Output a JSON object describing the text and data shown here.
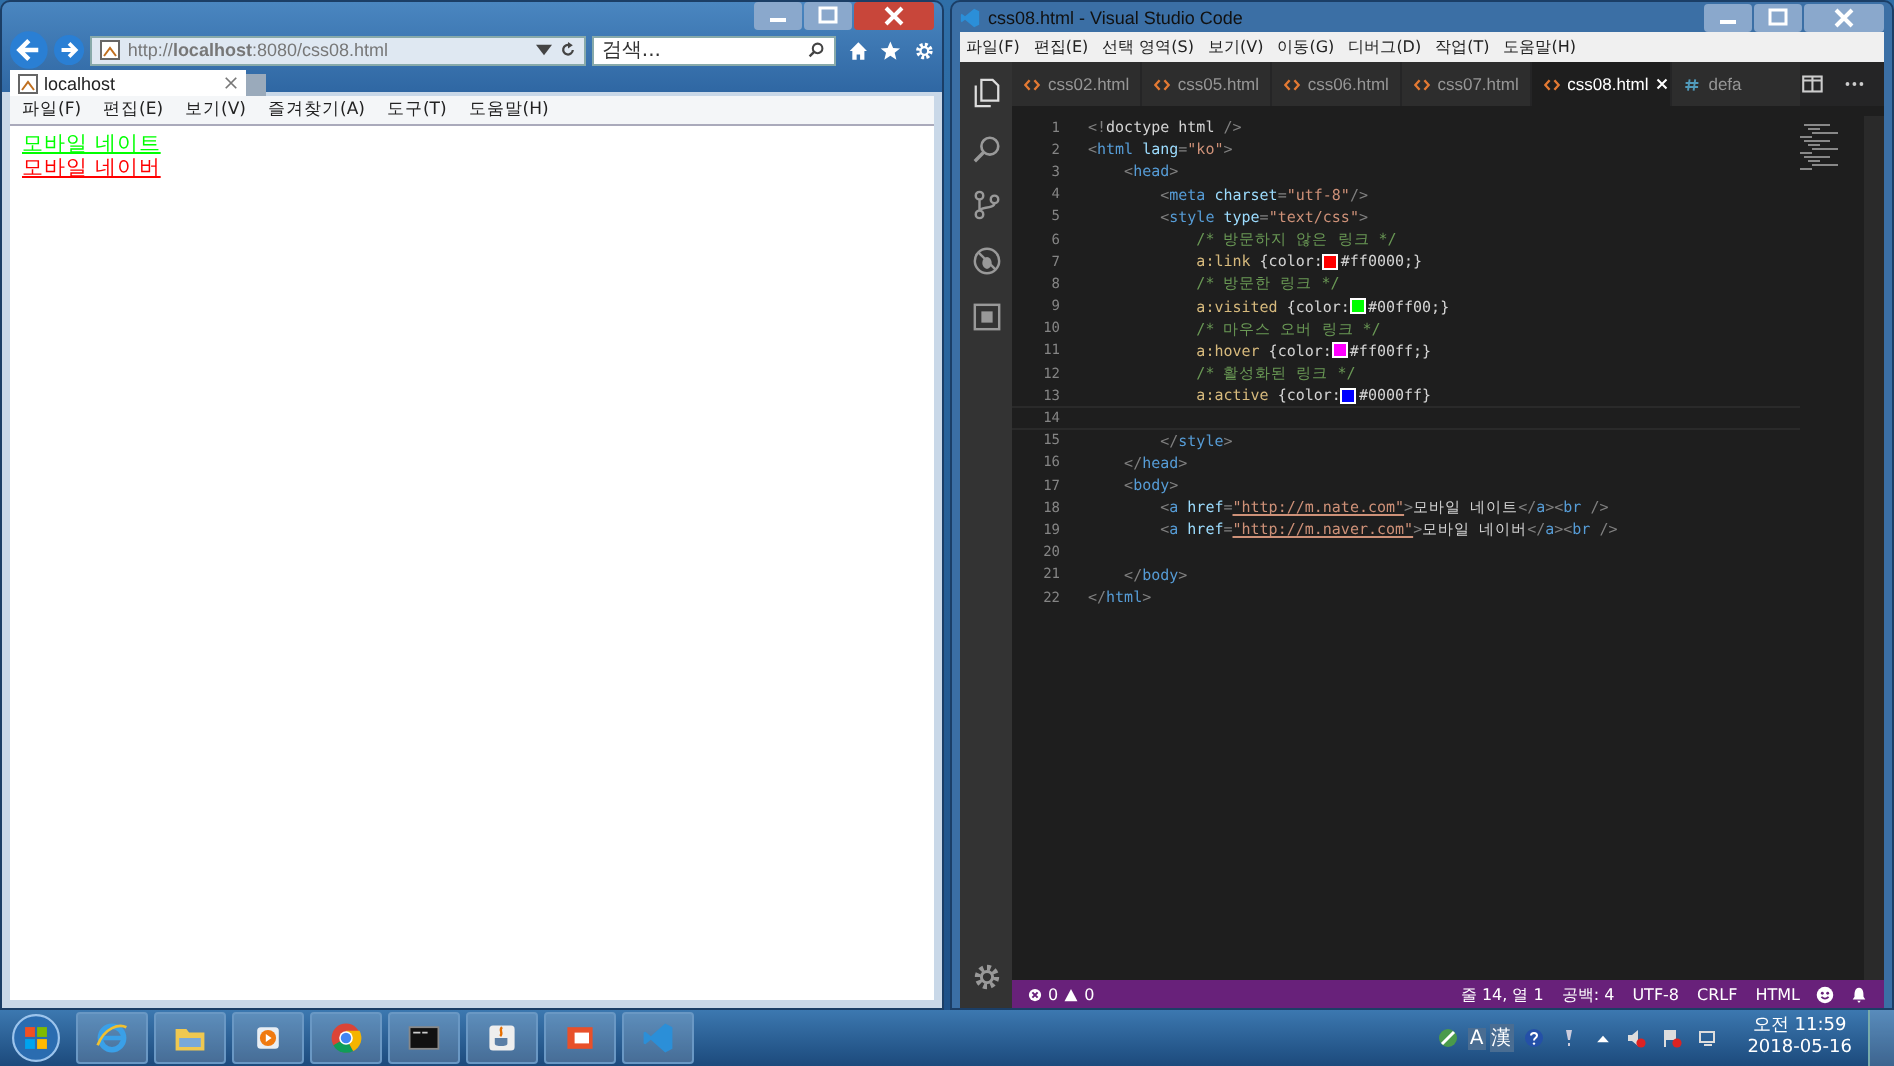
{
  "browser": {
    "address": "http://**localhost**:8080/css08.html",
    "search": {
      "placeholder": "검색..."
    },
    "tabs": [
      {
        "label": "localhost",
        "selected": true
      }
    ],
    "menu": [
      "파일(F)",
      "편집(E)",
      "보기(V)",
      "즐겨찾기(A)",
      "도구(T)",
      "도움말(H)"
    ],
    "links": [
      {
        "text": "모바일 네이트",
        "visited": true
      },
      {
        "text": "모바일 네이버",
        "visited": false
      }
    ]
  },
  "editor": {
    "title": "css08.html - Visual Studio Code",
    "menu": [
      "파일(F)",
      "편집(E)",
      "선택 영역(S)",
      "보기(V)",
      "이동(G)",
      "디버그(D)",
      "작업(T)",
      "도움말(H)"
    ],
    "tabs": [
      {
        "label": "css02.html",
        "kind": "html",
        "selected": false
      },
      {
        "label": "css05.html",
        "kind": "html",
        "selected": false
      },
      {
        "label": "css06.html",
        "kind": "html",
        "selected": false
      },
      {
        "label": "css07.html",
        "kind": "html",
        "selected": false
      },
      {
        "label": "css08.html",
        "kind": "html",
        "selected": true
      },
      {
        "label": "defa",
        "kind": "css",
        "selected": false
      }
    ],
    "lines": [
      {
        "number": "1",
        "tokens": [
          {
            "kind": "punct",
            "text": "<!"
          },
          {
            "kind": "text",
            "text": "doctype html"
          },
          {
            "kind": "punct",
            "text": " />"
          }
        ]
      },
      {
        "number": "2",
        "tokens": [
          {
            "kind": "punct",
            "text": "<"
          },
          {
            "kind": "tag",
            "text": "html"
          },
          {
            "kind": "attr",
            "text": " lang"
          },
          {
            "kind": "punct",
            "text": "="
          },
          {
            "kind": "string",
            "text": "\"ko\""
          },
          {
            "kind": "punct",
            "text": ">"
          }
        ]
      },
      {
        "number": "3",
        "tokens": [
          {
            "kind": "punct",
            "text": "    <"
          },
          {
            "kind": "tag",
            "text": "head"
          },
          {
            "kind": "punct",
            "text": ">"
          }
        ]
      },
      {
        "number": "4",
        "tokens": [
          {
            "kind": "punct",
            "text": "        <"
          },
          {
            "kind": "tag",
            "text": "meta"
          },
          {
            "kind": "attr",
            "text": " charset"
          },
          {
            "kind": "punct",
            "text": "="
          },
          {
            "kind": "string",
            "text": "\"utf-8\""
          },
          {
            "kind": "punct",
            "text": "/>"
          }
        ]
      },
      {
        "number": "5",
        "tokens": [
          {
            "kind": "punct",
            "text": "        <"
          },
          {
            "kind": "tag",
            "text": "style"
          },
          {
            "kind": "attr",
            "text": " type"
          },
          {
            "kind": "punct",
            "text": "="
          },
          {
            "kind": "string",
            "text": "\"text/css\""
          },
          {
            "kind": "punct",
            "text": ">"
          }
        ]
      },
      {
        "number": "6",
        "tokens": [
          {
            "kind": "comment",
            "text": "            /* 방문하지 않은 링크 */"
          }
        ]
      },
      {
        "number": "7",
        "tokens": [
          {
            "kind": "selector",
            "text": "            a:link"
          },
          {
            "kind": "text",
            "text": " {color:"
          },
          {
            "kind": "swatch",
            "color": "#ff0000"
          },
          {
            "kind": "value",
            "text": "#ff0000;"
          },
          {
            "kind": "text",
            "text": "}"
          }
        ]
      },
      {
        "number": "8",
        "tokens": [
          {
            "kind": "comment",
            "text": "            /* 방문한 링크 */"
          }
        ]
      },
      {
        "number": "9",
        "tokens": [
          {
            "kind": "selector",
            "text": "            a:visited"
          },
          {
            "kind": "text",
            "text": " {color:"
          },
          {
            "kind": "swatch",
            "color": "#00ff00"
          },
          {
            "kind": "value",
            "text": "#00ff00;"
          },
          {
            "kind": "text",
            "text": "}"
          }
        ]
      },
      {
        "number": "10",
        "tokens": [
          {
            "kind": "comment",
            "text": "            /* 마우스 오버 링크 */"
          }
        ]
      },
      {
        "number": "11",
        "tokens": [
          {
            "kind": "selector",
            "text": "            a:hover"
          },
          {
            "kind": "text",
            "text": " {color:"
          },
          {
            "kind": "swatch",
            "color": "#ff00ff"
          },
          {
            "kind": "value",
            "text": "#ff00ff;"
          },
          {
            "kind": "text",
            "text": "}"
          }
        ]
      },
      {
        "number": "12",
        "tokens": [
          {
            "kind": "comment",
            "text": "            /* 활성화된 링크 */"
          }
        ]
      },
      {
        "number": "13",
        "tokens": [
          {
            "kind": "selector",
            "text": "            a:active"
          },
          {
            "kind": "text",
            "text": " {color:"
          },
          {
            "kind": "swatch",
            "color": "#0000ff"
          },
          {
            "kind": "value",
            "text": "#0000ff"
          },
          {
            "kind": "text",
            "text": "}"
          }
        ]
      },
      {
        "number": "14",
        "current": true
      },
      {
        "number": "15",
        "tokens": [
          {
            "kind": "punct",
            "text": "        </"
          },
          {
            "kind": "tag",
            "text": "style"
          },
          {
            "kind": "punct",
            "text": ">"
          }
        ]
      },
      {
        "number": "16",
        "tokens": [
          {
            "kind": "punct",
            "text": "    </"
          },
          {
            "kind": "tag",
            "text": "head"
          },
          {
            "kind": "punct",
            "text": ">"
          }
        ]
      },
      {
        "number": "17",
        "tokens": [
          {
            "kind": "punct",
            "text": "    <"
          },
          {
            "kind": "tag",
            "text": "body"
          },
          {
            "kind": "punct",
            "text": ">"
          }
        ]
      },
      {
        "number": "18",
        "tokens": [
          {
            "kind": "punct",
            "text": "        <"
          },
          {
            "kind": "tag",
            "text": "a"
          },
          {
            "kind": "attr",
            "text": " href"
          },
          {
            "kind": "punct",
            "text": "="
          },
          {
            "kind": "url",
            "text": "\"http://m.nate.com\""
          },
          {
            "kind": "punct",
            "text": ">"
          },
          {
            "kind": "text",
            "text": "모바일 네이트"
          },
          {
            "kind": "punct",
            "text": "</"
          },
          {
            "kind": "tag",
            "text": "a"
          },
          {
            "kind": "punct",
            "text": "><"
          },
          {
            "kind": "tag",
            "text": "br"
          },
          {
            "kind": "punct",
            "text": " />"
          }
        ]
      },
      {
        "number": "19",
        "tokens": [
          {
            "kind": "punct",
            "text": "        <"
          },
          {
            "kind": "tag",
            "text": "a"
          },
          {
            "kind": "attr",
            "text": " href"
          },
          {
            "kind": "punct",
            "text": "="
          },
          {
            "kind": "url",
            "text": "\"http://m.naver.com\""
          },
          {
            "kind": "punct",
            "text": ">"
          },
          {
            "kind": "text",
            "text": "모바일 네이버"
          },
          {
            "kind": "punct",
            "text": "</"
          },
          {
            "kind": "tag",
            "text": "a"
          },
          {
            "kind": "punct",
            "text": "><"
          },
          {
            "kind": "tag",
            "text": "br"
          },
          {
            "kind": "punct",
            "text": " />"
          }
        ]
      },
      {
        "number": "20"
      },
      {
        "number": "21",
        "tokens": [
          {
            "kind": "punct",
            "text": "    </"
          },
          {
            "kind": "tag",
            "text": "body"
          },
          {
            "kind": "punct",
            "text": ">"
          }
        ]
      },
      {
        "number": "22",
        "tokens": [
          {
            "kind": "punct",
            "text": "</"
          },
          {
            "kind": "tag",
            "text": "html"
          },
          {
            "kind": "punct",
            "text": ">"
          }
        ]
      }
    ],
    "status": {
      "errors": "0",
      "warnings": "0",
      "items": [
        "줄 14, 열 1",
        "공백: 4",
        "UTF-8",
        "CRLF",
        "HTML"
      ]
    }
  },
  "taskbar": {
    "tray": [
      "A",
      "漢"
    ],
    "time": "오전 11:59",
    "date": "2018-05-16"
  }
}
